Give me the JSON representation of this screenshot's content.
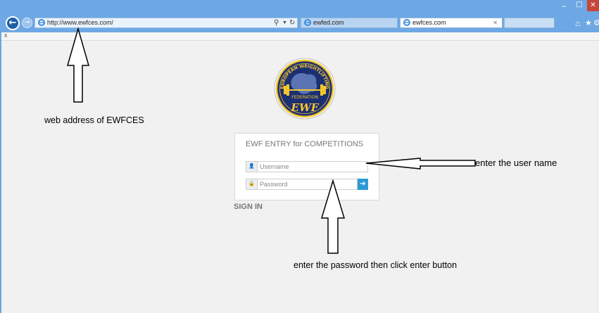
{
  "browser": {
    "url": "http://www.ewfces.com/",
    "tabs": [
      {
        "label": "ewfed.com",
        "active": false
      },
      {
        "label": "ewfces.com",
        "active": true
      }
    ],
    "notify_close": "x"
  },
  "login": {
    "title": "EWF ENTRY for COMPETITIONS",
    "username_placeholder": "Username",
    "password_placeholder": "Password",
    "enter_glyph": "➔",
    "signin_label": "SIGN IN"
  },
  "logo": {
    "top_text": "EUROPEAN WEIGHTLIFTING",
    "middle_text": "FEDERATION",
    "bottom_text": "EWF"
  },
  "annotations": {
    "address": "web address of EWFCES",
    "username": "enter the user name",
    "password": "enter the password then click enter button"
  },
  "colors": {
    "titlebar": "#6ea8e4",
    "enter_button": "#2c9ad6",
    "logo_navy": "#1c2f73",
    "logo_gold": "#f3c72b"
  }
}
